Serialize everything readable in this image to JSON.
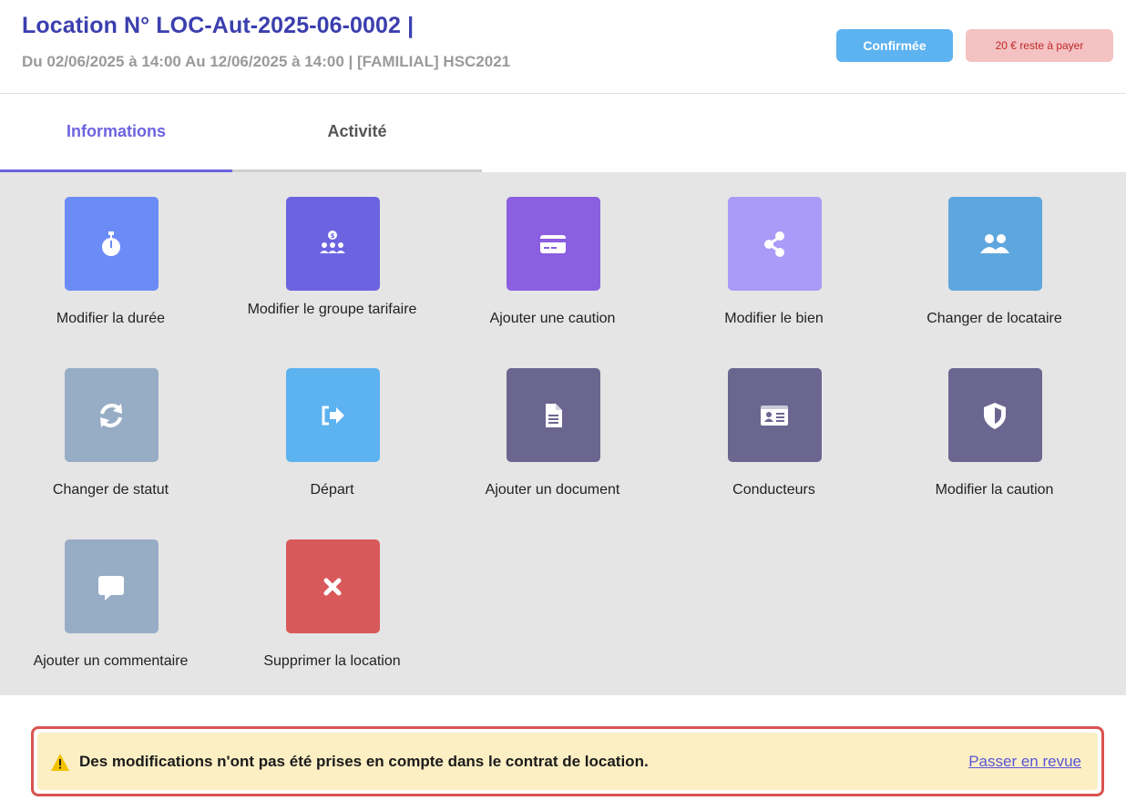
{
  "header": {
    "title": "Location N° LOC-Aut-2025-06-0002 |",
    "subtitle": "Du 02/06/2025 à 14:00 Au 12/06/2025 à 14:00 | [FAMILIAL] HSC2021",
    "status_badge": "Confirmée",
    "balance_badge": "20 € reste à payer"
  },
  "tabs": [
    {
      "label": "Informations",
      "active": true
    },
    {
      "label": "Activité",
      "active": false
    }
  ],
  "actions": [
    {
      "label": "Modifier la durée",
      "icon": "stopwatch-icon",
      "color": "#6b8cf7"
    },
    {
      "label": "Modifier le groupe tarifaire",
      "icon": "group-price-icon",
      "color": "#6c63e0"
    },
    {
      "label": "Ajouter une caution",
      "icon": "credit-card-icon",
      "color": "#8a5fe0"
    },
    {
      "label": "Modifier le bien",
      "icon": "share-icon",
      "color": "#a99bf7"
    },
    {
      "label": "Changer de locataire",
      "icon": "users-icon",
      "color": "#5ea6de"
    },
    {
      "label": "Changer de statut",
      "icon": "refresh-icon",
      "color": "#97acc5"
    },
    {
      "label": "Départ",
      "icon": "sign-out-icon",
      "color": "#5db2f0"
    },
    {
      "label": "Ajouter un document",
      "icon": "document-icon",
      "color": "#6b6690"
    },
    {
      "label": "Conducteurs",
      "icon": "id-card-icon",
      "color": "#6b6690"
    },
    {
      "label": "Modifier la caution",
      "icon": "shield-icon",
      "color": "#6b6690"
    },
    {
      "label": "Ajouter un commentaire",
      "icon": "comment-icon",
      "color": "#97acc5"
    },
    {
      "label": "Supprimer la location",
      "icon": "close-icon",
      "color": "#d9595a"
    }
  ],
  "alert": {
    "message": "Des modifications n'ont pas été prises en compte dans le contrat de location.",
    "link": "Passer en revue",
    "colors": {
      "background": "#fcefc4",
      "border": "#d9534f"
    }
  }
}
